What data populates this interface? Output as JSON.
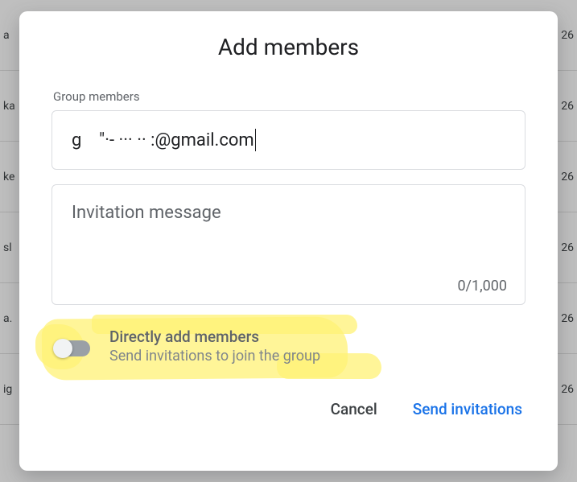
{
  "background_rows": [
    {
      "left": "a",
      "right": "26"
    },
    {
      "left": "ka",
      "right": "26"
    },
    {
      "left": "ke",
      "right": "26"
    },
    {
      "left": "sl",
      "right": "26"
    },
    {
      "left": "a.",
      "right": "26"
    },
    {
      "left": "ig",
      "right": "26"
    }
  ],
  "dialog": {
    "title": "Add members",
    "group_members_label": "Group members",
    "group_members_value": "g    \"·- ··· ·· :@gmail.com",
    "invitation_placeholder": "Invitation message",
    "char_count": "0/1,000",
    "toggle": {
      "title": "Directly add members",
      "subtitle": "Send invitations to join the group",
      "state": "off"
    },
    "actions": {
      "cancel": "Cancel",
      "send": "Send invitations"
    }
  }
}
